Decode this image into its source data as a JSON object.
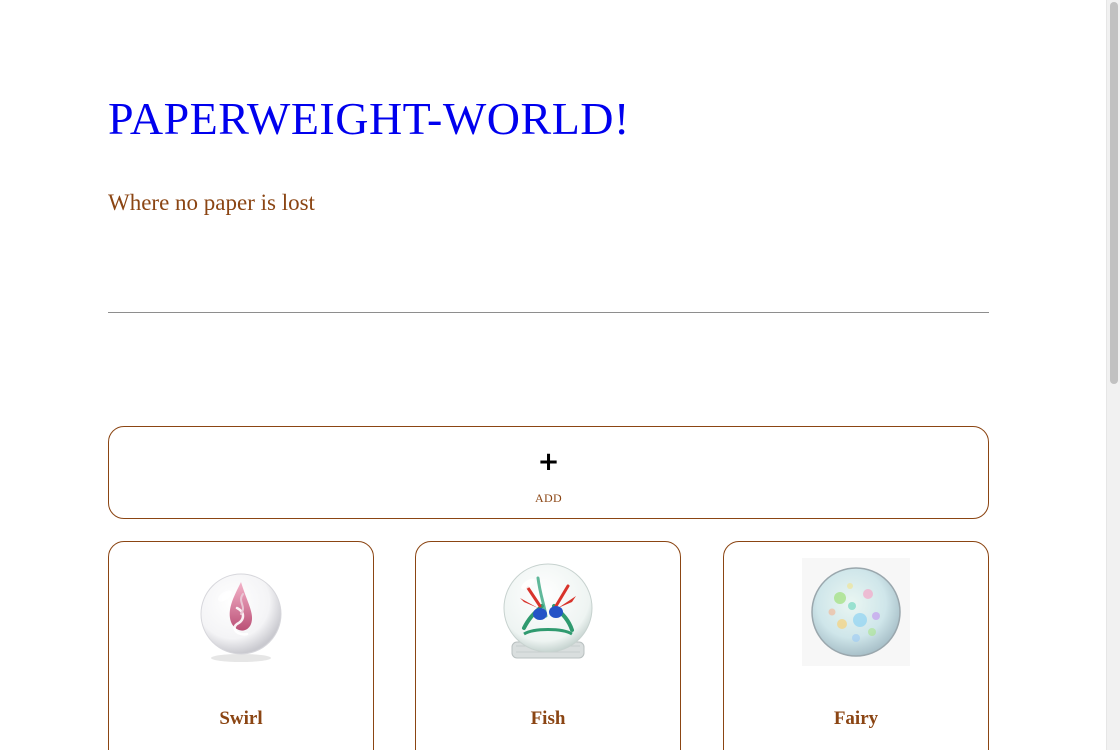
{
  "site": {
    "title": "PAPERWEIGHT-WORLD!",
    "tagline": "Where no paper is lost"
  },
  "add_button": {
    "icon": "plus-icon",
    "label": "ADD"
  },
  "products": [
    {
      "name": "Swirl",
      "image": "swirl-paperweight-image"
    },
    {
      "name": "Fish",
      "image": "fish-paperweight-image"
    },
    {
      "name": "Fairy",
      "image": "fairy-paperweight-image"
    }
  ],
  "colors": {
    "title": "#0000ee",
    "accent": "#8b4513",
    "divider": "#8e8e8e"
  }
}
